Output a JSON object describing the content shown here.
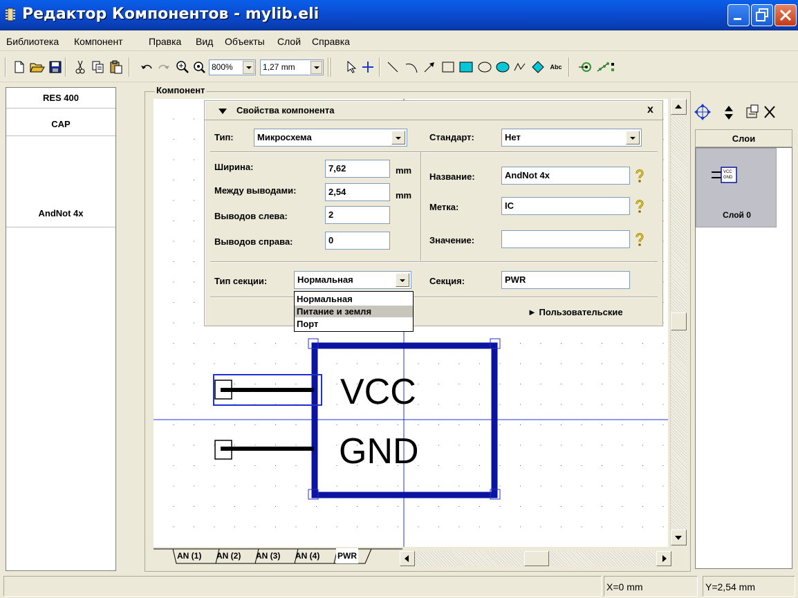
{
  "window": {
    "title": "Редактор Компонентов - mylib.eli"
  },
  "menu": [
    "Библиотека",
    "Компонент",
    "Правка",
    "Вид",
    "Объекты",
    "Слой",
    "Справка"
  ],
  "toolbar": {
    "zoom_value": "800%",
    "grid_value": "1,27 mm",
    "text_tool_label": "Abc"
  },
  "library_list": {
    "items": [
      "RES 400",
      "CAP",
      "AndNot 4x"
    ]
  },
  "component_group": {
    "label": "Компонент"
  },
  "properties": {
    "title": "Свойства компонента",
    "close_label": "x",
    "type_label": "Тип:",
    "type_value": "Микросхема",
    "standard_label": "Стандарт:",
    "standard_value": "Нет",
    "width_label": "Ширина:",
    "width_value": "7,62",
    "width_unit": "mm",
    "pitch_label": "Между выводами:",
    "pitch_value": "2,54",
    "pitch_unit": "mm",
    "pins_left_label": "Выводов слева:",
    "pins_left_value": "2",
    "pins_right_label": "Выводов справа:",
    "pins_right_value": "0",
    "name_label": "Название:",
    "name_value": "AndNot 4x",
    "mark_label": "Метка:",
    "mark_value": "IC",
    "value_label": "Значение:",
    "value_value": "",
    "section_type_label": "Тип секции:",
    "section_type_value": "Нормальная",
    "section_label": "Секция:",
    "section_value": "PWR",
    "custom_label": "► Пользовательские"
  },
  "section_type_options": [
    "Нормальная",
    "Питание и земля",
    "Порт"
  ],
  "section_type_highlighted": "Питание и земля",
  "canvas": {
    "pin_labels": [
      "VCC",
      "GND"
    ]
  },
  "section_tabs": [
    "AN (1)",
    "AN (2)",
    "AN (3)",
    "AN (4)",
    "PWR"
  ],
  "active_tab": "PWR",
  "layers": {
    "header": "Слои",
    "items": [
      "Слой 0"
    ],
    "thumb_text": [
      "VCC",
      "GND"
    ]
  },
  "status": {
    "x": "X=0 mm",
    "y": "Y=2,54 mm"
  },
  "colors": {
    "title_bar": "#0b4ed6",
    "component_outline": "#0a14a0",
    "selection": "#2030d0",
    "crosshair": "#2030d0",
    "face": "#ece9d8"
  }
}
